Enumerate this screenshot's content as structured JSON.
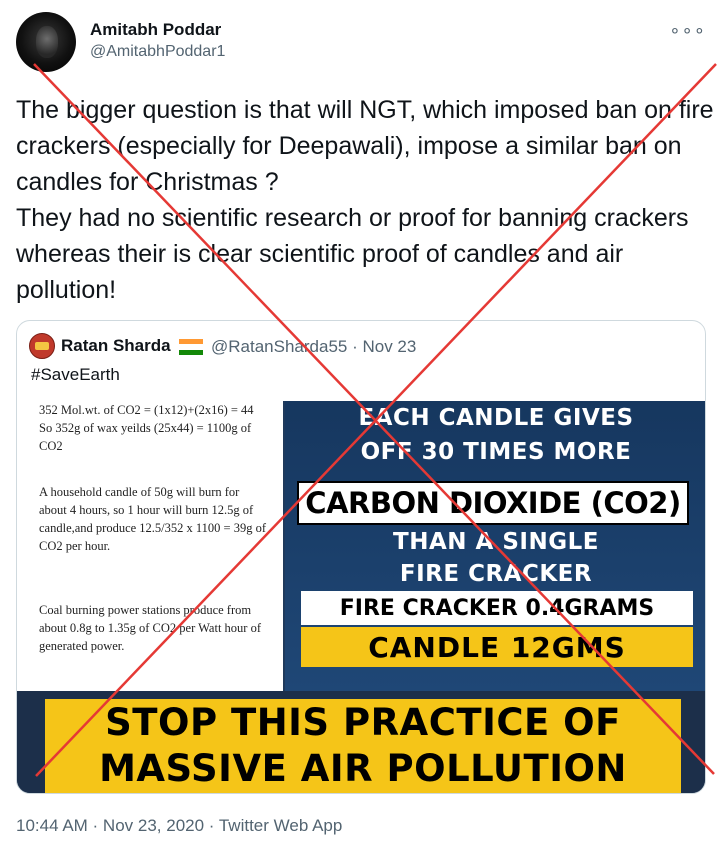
{
  "author": {
    "name": "Amitabh Poddar",
    "handle": "@AmitabhPoddar1"
  },
  "more_icon": "more-horizontal-icon",
  "tweet_text": "The bigger question is that will NGT, which imposed ban on fire crackers (especially for Deepawali), impose a similar ban on candles for Christmas ?\nThey had no scientific research or proof for banning crackers whereas their is clear scientific proof of candles and air pollution!",
  "quoted": {
    "name": "Ratan Sharda",
    "flag_icon": "india-flag-icon",
    "handle_date": "@RatanSharda55 · Nov 23",
    "text": "#SaveEarth",
    "image": {
      "left_paragraphs": [
        "352 Mol.wt. of CO2 = (1x12)+(2x16) = 44 So 352g of wax yeilds (25x44) = 1100g of CO2",
        "A household candle of 50g will burn for about 4 hours, so 1 hour will burn 12.5g of candle,and produce 12.5/352 x 1100 = 39g of CO2 per hour.",
        "Coal burning power stations produce from about 0.8g to 1.35g of CO2 per Watt hour of generated power."
      ],
      "headline_1": "EACH CANDLE GIVES",
      "headline_2": "OFF 30 TIMES MORE",
      "co2": "CARBON DIOXIDE (CO2)",
      "than_1": "THAN A SINGLE",
      "than_2": "FIRE CRACKER",
      "fire_cracker": "FIRE CRACKER 0.4GRAMS",
      "candle": "CANDLE  12GMS",
      "banner_1": "STOP THIS PRACTICE OF",
      "banner_2": "MASSIVE AIR POLLUTION"
    }
  },
  "timestamp": "10:44 AM · Nov 23, 2020 · Twitter Web App",
  "colors": {
    "cross": "#e53935",
    "accent_yellow": "#f5c518",
    "image_blue": "#1f4776"
  }
}
